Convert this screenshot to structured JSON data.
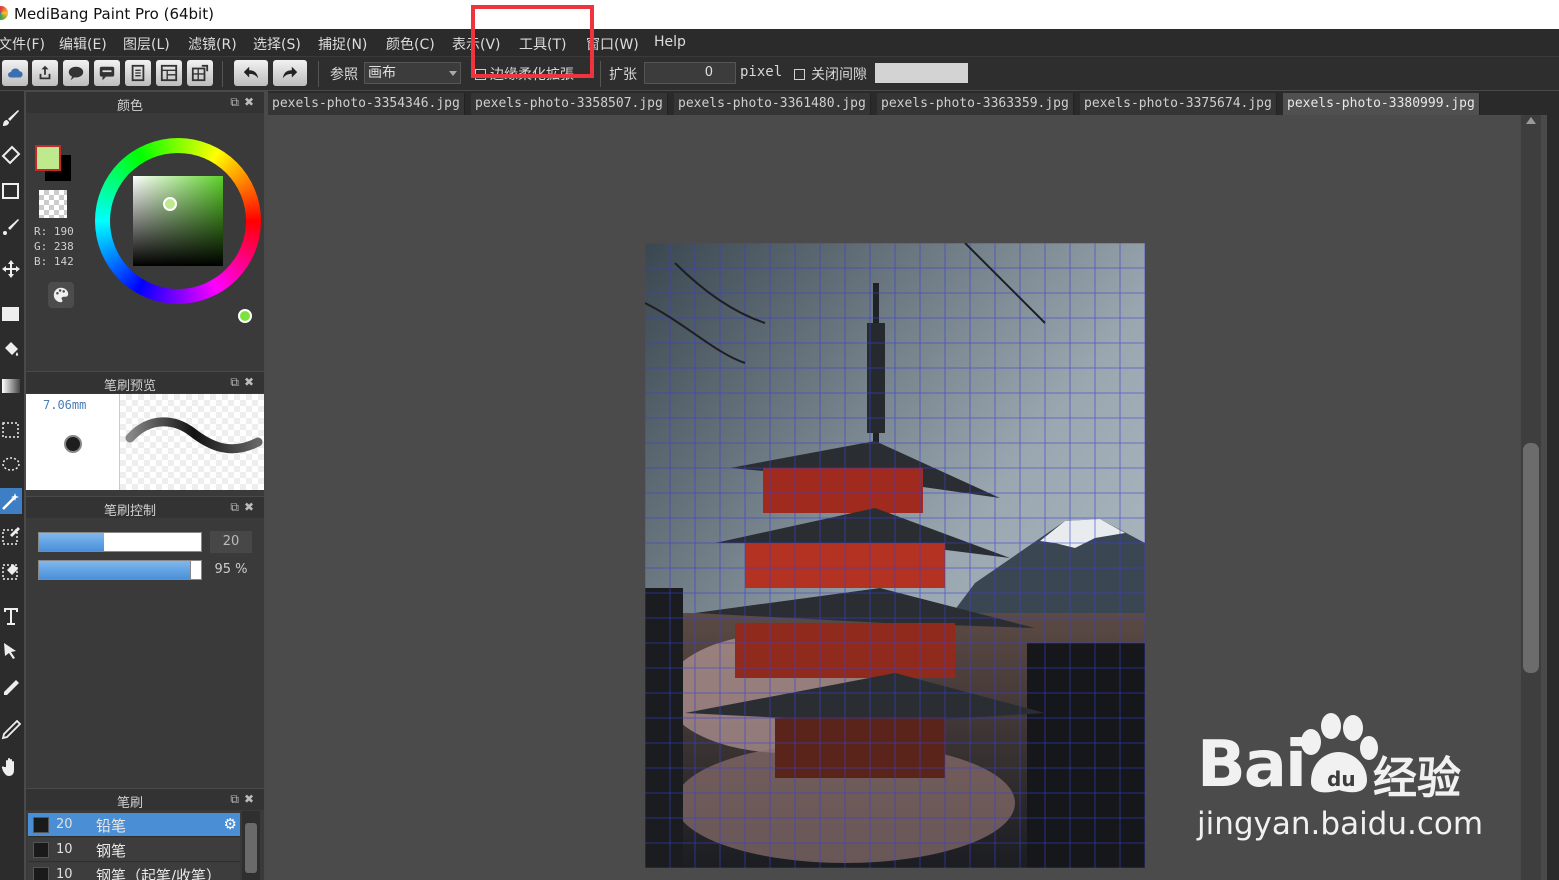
{
  "window": {
    "title": "MediBang Paint Pro (64bit)"
  },
  "menu": [
    {
      "label": "文件(F)"
    },
    {
      "label": "编辑(E)"
    },
    {
      "label": "图层(L)"
    },
    {
      "label": "滤镜(R)"
    },
    {
      "label": "选择(S)"
    },
    {
      "label": "捕捉(N)"
    },
    {
      "label": "颜色(C)"
    },
    {
      "label": "表示(V)"
    },
    {
      "label": "工具(T)"
    },
    {
      "label": "窗口(W)"
    },
    {
      "label": "Help"
    }
  ],
  "toolbar": {
    "ref_label": "参照",
    "ref_value": "画布",
    "antialias_label": "边缘柔化拡張",
    "expand_label": "扩张",
    "expand_value": "0",
    "expand_unit": "pixel",
    "close_gap_label": "关闭间隙"
  },
  "color_panel": {
    "title": "颜色",
    "foreground": "#bee98e",
    "background": "#000000",
    "r": "R: 190",
    "g": "G: 238",
    "b": "B: 142"
  },
  "brush_preview": {
    "title": "笔刷预览",
    "size": "7.06mm"
  },
  "brush_control": {
    "title": "笔刷控制",
    "size_value": "20",
    "size_fraction": 0.4,
    "opacity_value": "95 %",
    "opacity_fraction": 0.95
  },
  "brush_list": {
    "title": "笔刷",
    "items": [
      {
        "size": "20",
        "name": "铅笔",
        "selected": true
      },
      {
        "size": "10",
        "name": "钢笔",
        "selected": false
      },
      {
        "size": "10",
        "name": "钢笔（起笔/收笔）",
        "selected": false
      }
    ]
  },
  "tabs": [
    {
      "label": "pexels-photo-3354346.jpg",
      "active": false
    },
    {
      "label": "pexels-photo-3358507.jpg",
      "active": false
    },
    {
      "label": "pexels-photo-3361480.jpg",
      "active": false
    },
    {
      "label": "pexels-photo-3363359.jpg",
      "active": false
    },
    {
      "label": "pexels-photo-3375674.jpg",
      "active": false
    },
    {
      "label": "pexels-photo-3380999.jpg",
      "active": true
    }
  ],
  "watermark": {
    "brand": "Bai",
    "brand2": "经验",
    "url": "jingyan.baidu.com"
  },
  "colors": {
    "accent": "#4a8fd6",
    "highlight": "#f0343e"
  }
}
